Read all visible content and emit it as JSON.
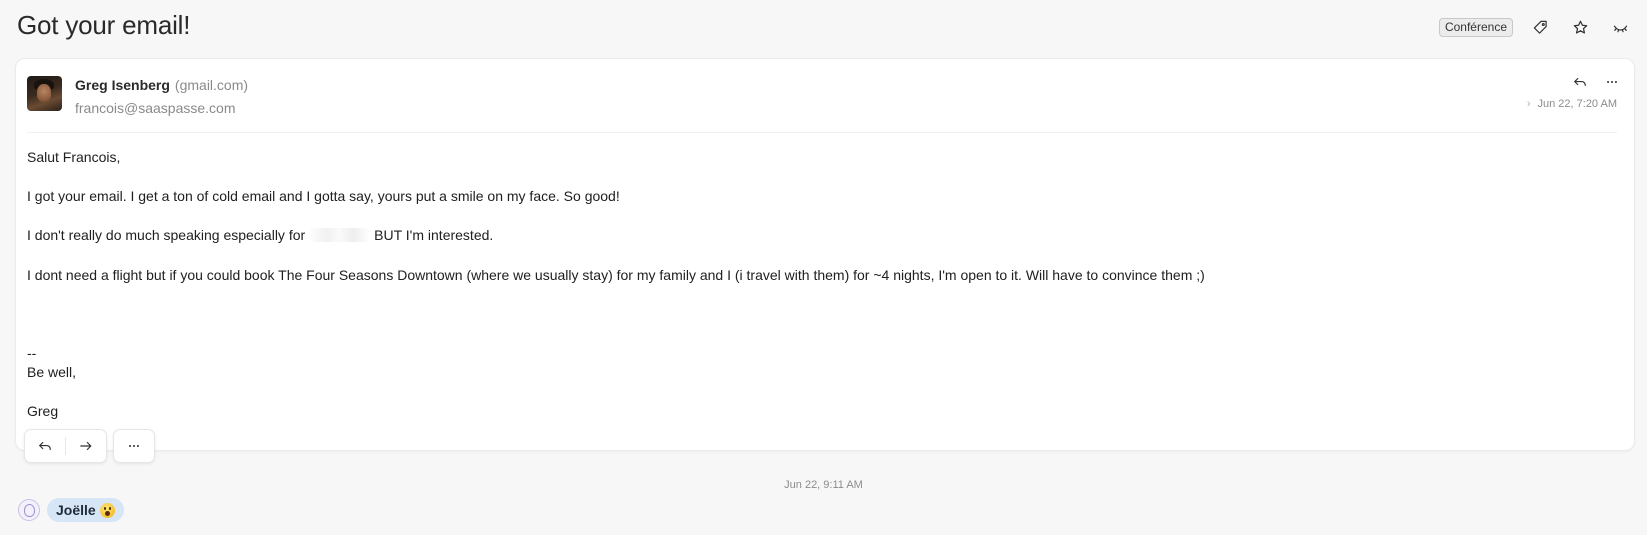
{
  "subject": "Got your email!",
  "header": {
    "label": "Conférence",
    "icons": [
      "tag-icon",
      "star-icon",
      "hide-icon"
    ]
  },
  "message": {
    "sender_name": "Greg Isenberg",
    "sender_domain": "(gmail.com)",
    "recipient": "francois@saaspasse.com",
    "date": "Jun 22, 7:20 AM",
    "greeting": "Salut Francois,",
    "para1": "I got your email. I get a ton of cold email and I gotta say, yours put a smile on my face. So good!",
    "para2_before": "I don't really do much speaking especially for",
    "para2_after": "BUT I'm interested.",
    "para3": "I dont need a flight but if you could book The Four Seasons Downtown (where we usually stay) for my family and I (i travel with them) for ~4 nights, I'm open to it. Will have to convince them ;)",
    "sig_dash": "--",
    "sig_well": "Be well,",
    "sig_name": "Greg"
  },
  "followup": {
    "date": "Jun 22, 9:11 AM",
    "name": "Joëlle"
  },
  "colors": {
    "background": "#f7f7f7",
    "chip": "#d6e6f7"
  }
}
